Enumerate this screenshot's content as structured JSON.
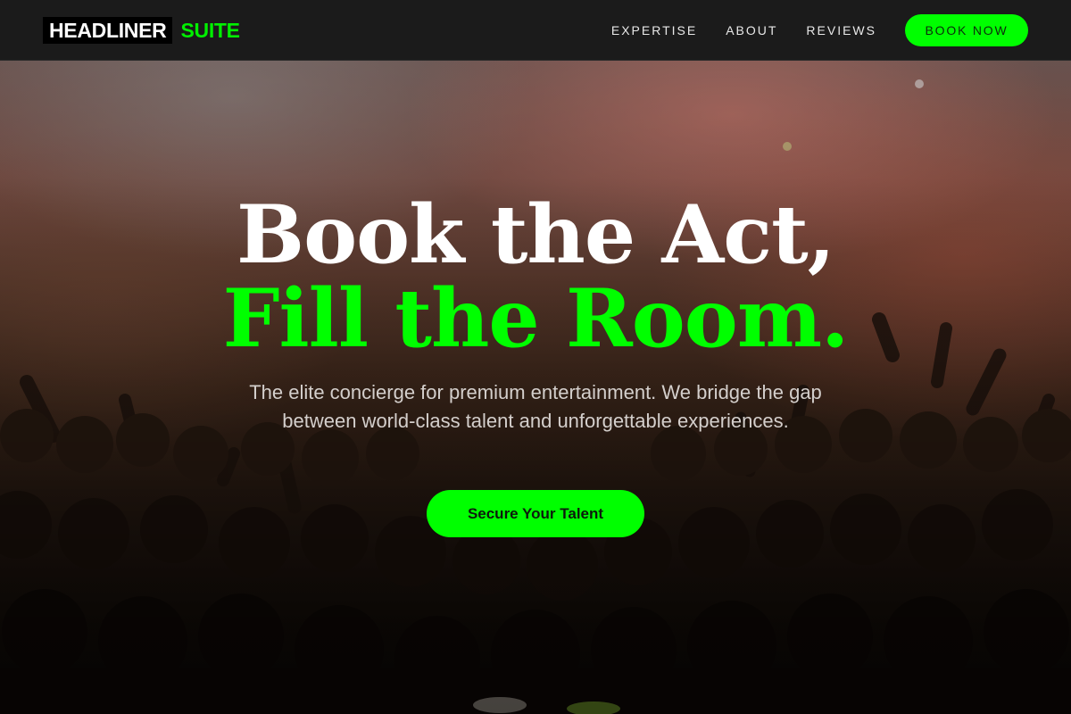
{
  "brand": {
    "name_main": "HEADLINER",
    "name_accent": "SUITE"
  },
  "nav": {
    "links": [
      "EXPERTISE",
      "ABOUT",
      "REVIEWS"
    ],
    "book_label": "BOOK NOW"
  },
  "hero": {
    "headline_line1": "Book the Act,",
    "headline_line2": "Fill the Room.",
    "subtitle": "The elite concierge for premium entertainment. We bridge the gap between world-class talent and unforgettable experiences.",
    "cta_label": "Secure Your Talent"
  },
  "colors": {
    "accent": "#00ff00",
    "header_bg": "#1b1b1b",
    "text_light": "#ffffff"
  }
}
